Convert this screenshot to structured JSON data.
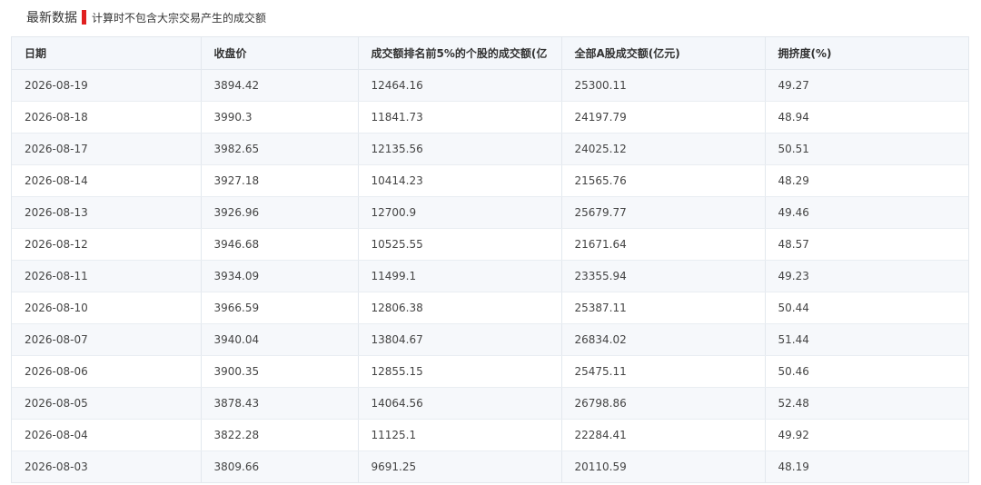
{
  "header": {
    "title": "最新数据",
    "note": "计算时不包含大宗交易产生的成交额",
    "accent_color": "#e02020"
  },
  "table": {
    "columns": [
      "日期",
      "收盘价",
      "成交额排名前5%的个股的成交额(亿",
      "全部A股成交额(亿元)",
      "拥挤度(%)"
    ],
    "rows": [
      [
        "2026-08-19",
        "3894.42",
        "12464.16",
        "25300.11",
        "49.27"
      ],
      [
        "2026-08-18",
        "3990.3",
        "11841.73",
        "24197.79",
        "48.94"
      ],
      [
        "2026-08-17",
        "3982.65",
        "12135.56",
        "24025.12",
        "50.51"
      ],
      [
        "2026-08-14",
        "3927.18",
        "10414.23",
        "21565.76",
        "48.29"
      ],
      [
        "2026-08-13",
        "3926.96",
        "12700.9",
        "25679.77",
        "49.46"
      ],
      [
        "2026-08-12",
        "3946.68",
        "10525.55",
        "21671.64",
        "48.57"
      ],
      [
        "2026-08-11",
        "3934.09",
        "11499.1",
        "23355.94",
        "49.23"
      ],
      [
        "2026-08-10",
        "3966.59",
        "12806.38",
        "25387.11",
        "50.44"
      ],
      [
        "2026-08-07",
        "3940.04",
        "13804.67",
        "26834.02",
        "51.44"
      ],
      [
        "2026-08-06",
        "3900.35",
        "12855.15",
        "25475.11",
        "50.46"
      ],
      [
        "2026-08-05",
        "3878.43",
        "14064.56",
        "26798.86",
        "52.48"
      ],
      [
        "2026-08-04",
        "3822.28",
        "11125.1",
        "22284.41",
        "49.92"
      ],
      [
        "2026-08-03",
        "3809.66",
        "9691.25",
        "20110.59",
        "48.19"
      ]
    ]
  }
}
